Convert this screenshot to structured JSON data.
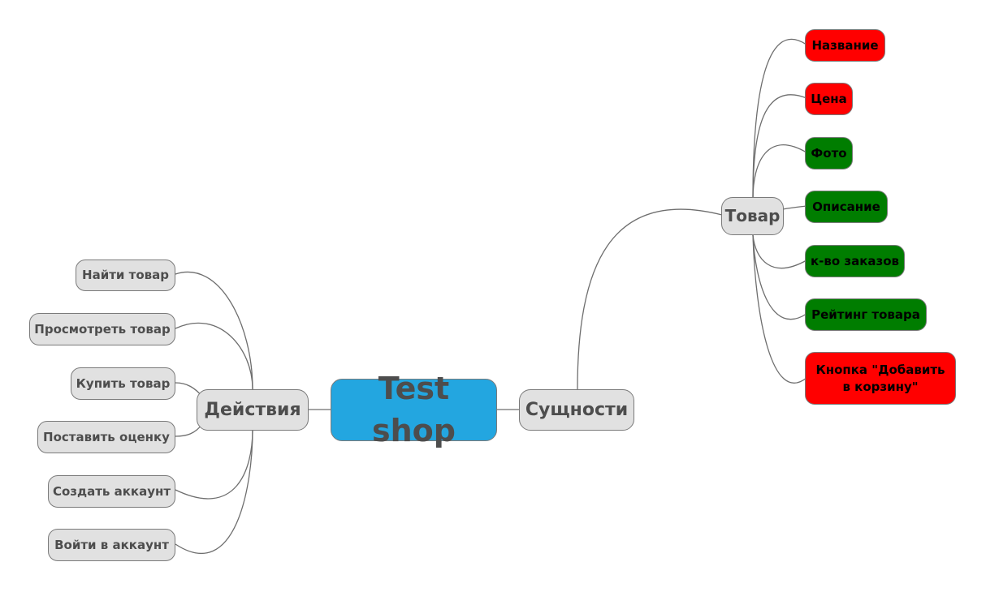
{
  "root": {
    "label": "Test shop",
    "color": "#23a6e0"
  },
  "left_branch": {
    "label": "Действия",
    "children": [
      {
        "label": "Найти товар"
      },
      {
        "label": "Просмотреть товар"
      },
      {
        "label": "Купить товар"
      },
      {
        "label": "Поставить оценку"
      },
      {
        "label": "Создать аккаунт"
      },
      {
        "label": "Войти в аккаунт"
      }
    ]
  },
  "right_branch": {
    "label": "Сущности",
    "sub": {
      "label": "Товар",
      "children": [
        {
          "label": "Название",
          "status": "red"
        },
        {
          "label": "Цена",
          "status": "red"
        },
        {
          "label": "Фото",
          "status": "green"
        },
        {
          "label": "Описание",
          "status": "green"
        },
        {
          "label": "к-во заказов",
          "status": "green"
        },
        {
          "label": "Рейтинг товара",
          "status": "green"
        },
        {
          "label": "Кнопка \"Добавить в корзину\"",
          "status": "red"
        }
      ]
    }
  },
  "colors": {
    "red": "#ff0000",
    "green": "#007d00",
    "node_gray": "#e1e1e1",
    "edge": "#6e6e6e"
  }
}
